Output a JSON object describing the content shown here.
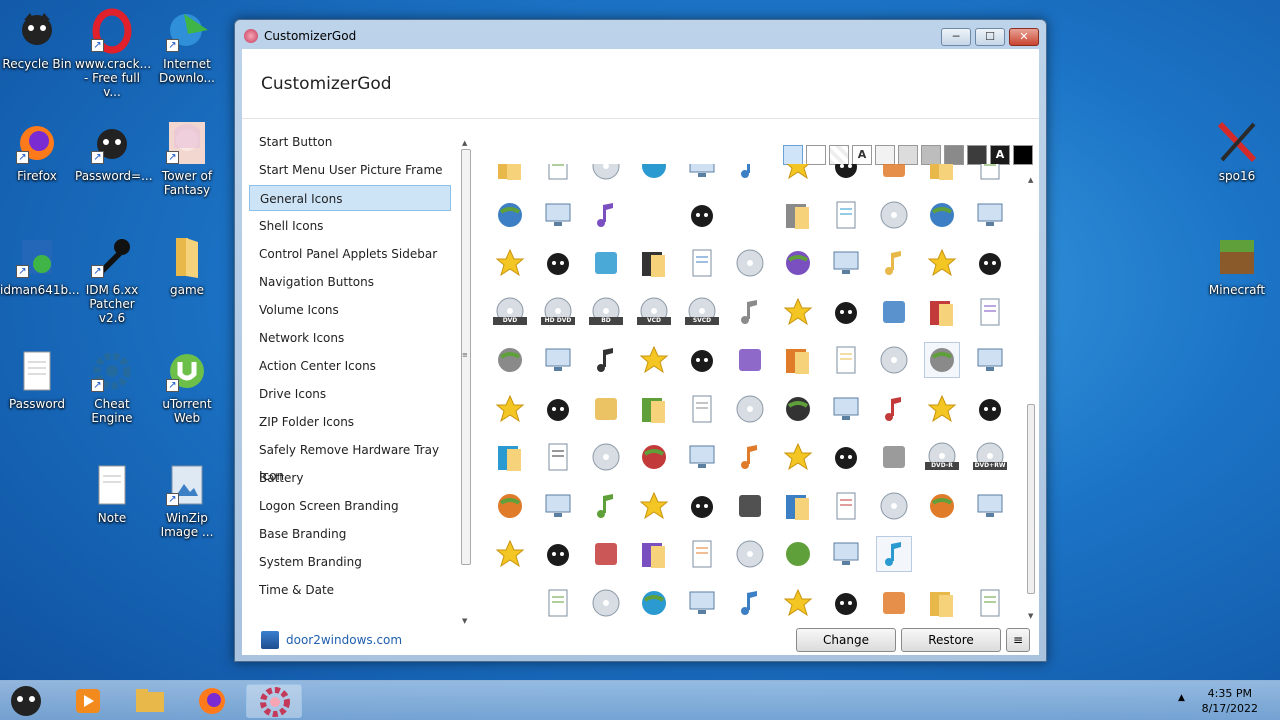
{
  "desktop": {
    "icons": [
      {
        "label": "Recycle Bin"
      },
      {
        "label": "www.crack...\n- Free full v..."
      },
      {
        "label": "Internet\nDownlo..."
      },
      {
        "label": "Firefox"
      },
      {
        "label": "Password=..."
      },
      {
        "label": "Tower of\nFantasy"
      },
      {
        "label": "idman641b..."
      },
      {
        "label": "IDM 6.xx\nPatcher v2.6"
      },
      {
        "label": "game"
      },
      {
        "label": "Password"
      },
      {
        "label": "Cheat Engine"
      },
      {
        "label": "uTorrent\nWeb"
      },
      {
        "label": "Note"
      },
      {
        "label": "WinZip\nImage ..."
      },
      {
        "label": "spo16"
      },
      {
        "label": "Minecraft"
      }
    ]
  },
  "window": {
    "title": "CustomizerGod",
    "controls": {
      "minimize": "─",
      "maximize": "☐",
      "close": "✕"
    },
    "header_title": "CustomizerGod",
    "nav": [
      "Start Button",
      "Start Menu User Picture Frame",
      "General Icons",
      "Shell Icons",
      "Control Panel Applets Sidebar",
      "Navigation Buttons",
      "Volume Icons",
      "Network Icons",
      "Action Center Icons",
      "Drive Icons",
      "ZIP Folder Icons",
      "Safely Remove Hardware Tray Icon",
      "Battery",
      "Logon Screen Branding",
      "Base Branding",
      "System Branding",
      "Time & Date"
    ],
    "selected_nav": "General Icons",
    "swatch_letters": {
      "a1": "A",
      "a2": "A"
    },
    "footer": {
      "link": "door2windows.com",
      "change": "Change",
      "restore": "Restore",
      "menu": "≡"
    },
    "icon_labels": {
      "dvd": "DVD",
      "hddvd": "HD DVD",
      "bd": "BD",
      "vcd": "VCD",
      "svcd": "SVCD",
      "dvdr": "DVD-R",
      "dvdrw": "DVD+RW"
    }
  },
  "taskbar": {
    "time": "4:35 PM",
    "date": "8/17/2022",
    "tray_arrow": "▲"
  },
  "colors": {
    "accent": "#cde4f7",
    "link": "#1f5fae",
    "desktop": "#1c74c6"
  }
}
